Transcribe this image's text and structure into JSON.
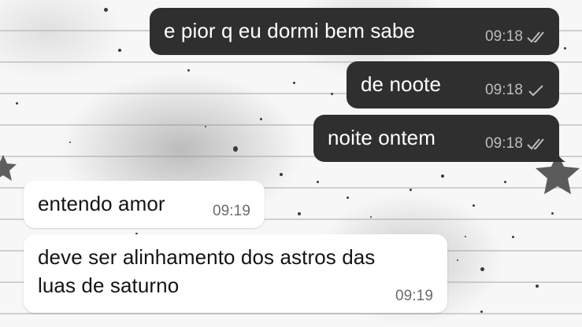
{
  "conversation": {
    "messages": [
      {
        "direction": "outgoing",
        "text": "e pior q eu dormi bem sabe",
        "time": "09:18",
        "status": "read"
      },
      {
        "direction": "outgoing",
        "text": "de noote",
        "time": "09:18",
        "status": "sent"
      },
      {
        "direction": "outgoing",
        "text": "noite ontem",
        "time": "09:18",
        "status": "read"
      },
      {
        "direction": "incoming",
        "text": "entendo amor",
        "time": "09:19"
      },
      {
        "direction": "incoming",
        "text_lines": [
          "deve ser alinhamento dos astros das",
          "luas de saturno"
        ],
        "time": "09:19"
      }
    ]
  },
  "theme": {
    "outgoing_bubble": "#2f2f2f",
    "incoming_bubble": "#ffffff",
    "wallpaper": "grey lined paper with stars and specks"
  },
  "icons": {
    "double_check": "double-check-icon",
    "single_check": "check-icon",
    "star": "star-icon"
  }
}
